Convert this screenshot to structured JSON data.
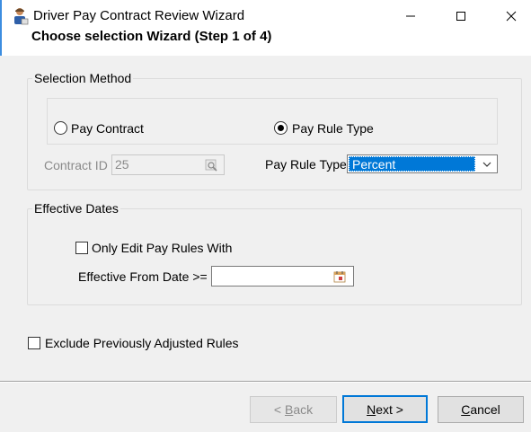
{
  "window": {
    "title": "Driver Pay Contract Review Wizard",
    "subtitle": "Choose selection Wizard (Step 1 of 4)"
  },
  "selection_method": {
    "group_label": "Selection Method",
    "options": [
      {
        "label": "Pay Contract",
        "selected": false
      },
      {
        "label": "Pay Rule Type",
        "selected": true
      }
    ],
    "contract_id_label": "Contract ID",
    "contract_id_value": "25",
    "pay_rule_type_label": "Pay Rule Type",
    "pay_rule_type_value": "Percent"
  },
  "effective_dates": {
    "group_label": "Effective Dates",
    "only_edit_label": "Only Edit Pay Rules With",
    "only_edit_checked": false,
    "from_date_label": "Effective From Date >=",
    "from_date_value": ""
  },
  "exclude_label": "Exclude Previously Adjusted Rules",
  "exclude_checked": false,
  "buttons": {
    "back_prefix": "< ",
    "back_hotkey": "B",
    "back_rest": "ack",
    "next_hotkey": "N",
    "next_rest": "ext >",
    "cancel_hotkey": "C",
    "cancel_rest": "ancel"
  },
  "icons": {
    "app": "driver-person-icon",
    "lookup": "magnifier-lookup-icon",
    "calendar": "calendar-icon",
    "dropdown": "chevron-down-icon"
  },
  "colors": {
    "accent": "#0078d7",
    "disabled_text": "#8a8a8a"
  }
}
